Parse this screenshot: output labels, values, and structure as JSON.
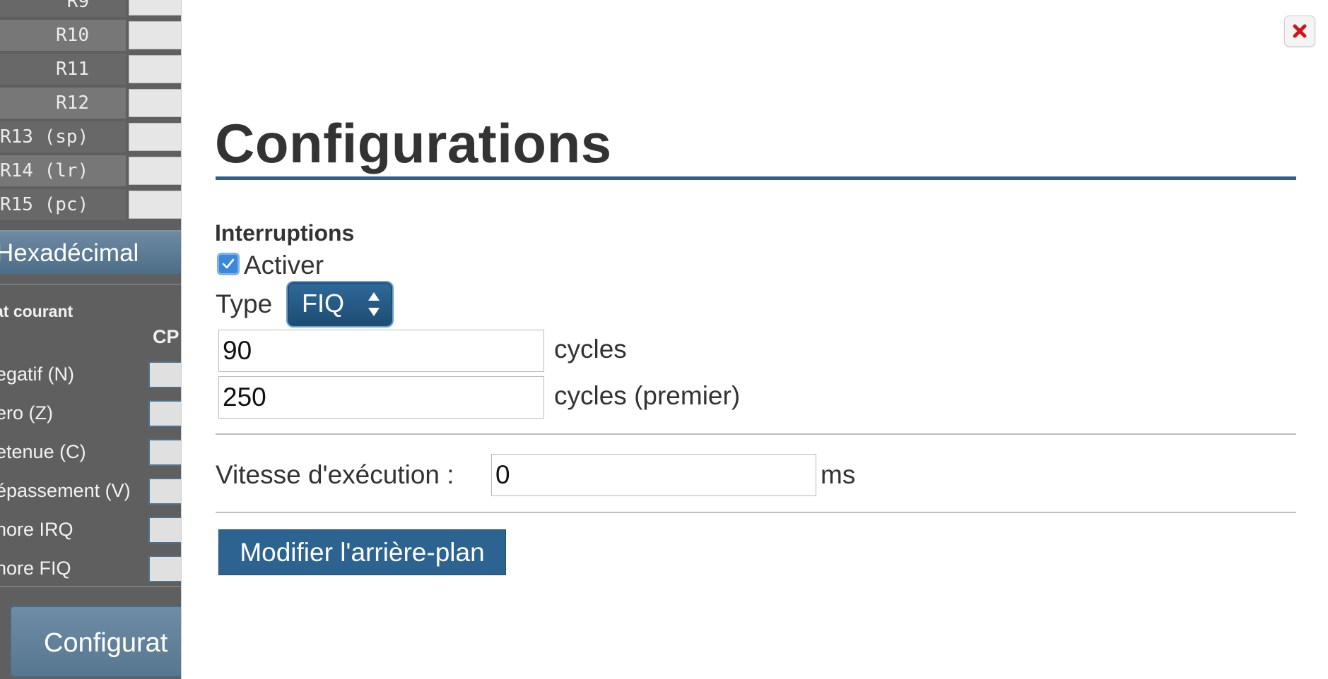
{
  "registers": [
    {
      "label": "R9",
      "alt": false
    },
    {
      "label": "R10",
      "alt": true
    },
    {
      "label": "R11",
      "alt": false
    },
    {
      "label": "R12",
      "alt": true
    },
    {
      "label": "R13 (sp)",
      "alt": false
    },
    {
      "label": "R14 (lr)",
      "alt": true
    },
    {
      "label": "R15 (pc)",
      "alt": false
    }
  ],
  "sidebar": {
    "hex_button": "Hexadécimal",
    "state_heading": "at courant",
    "cpsr_header": "CP",
    "flags": [
      "egatif (N)",
      "ero (Z)",
      "etenue (C)",
      "épassement (V)",
      "nore IRQ",
      "nore FIQ"
    ],
    "config_button": "Configurat"
  },
  "modal": {
    "title": "Configurations",
    "close_icon": "close-icon",
    "interruptions": {
      "heading": "Interruptions",
      "enable_label": "Activer",
      "enabled": true,
      "type_label": "Type",
      "type_value": "FIQ",
      "cycles_value": "90",
      "cycles_unit": "cycles",
      "first_value": "250",
      "first_unit": "cycles (premier)"
    },
    "speed": {
      "label": "Vitesse d'exécution :",
      "value": "0",
      "unit": "ms"
    },
    "background_button": "Modifier l'arrière-plan"
  },
  "colors": {
    "accent": "#2e5f89",
    "button": "#2d6390",
    "close": "#d0141c"
  }
}
